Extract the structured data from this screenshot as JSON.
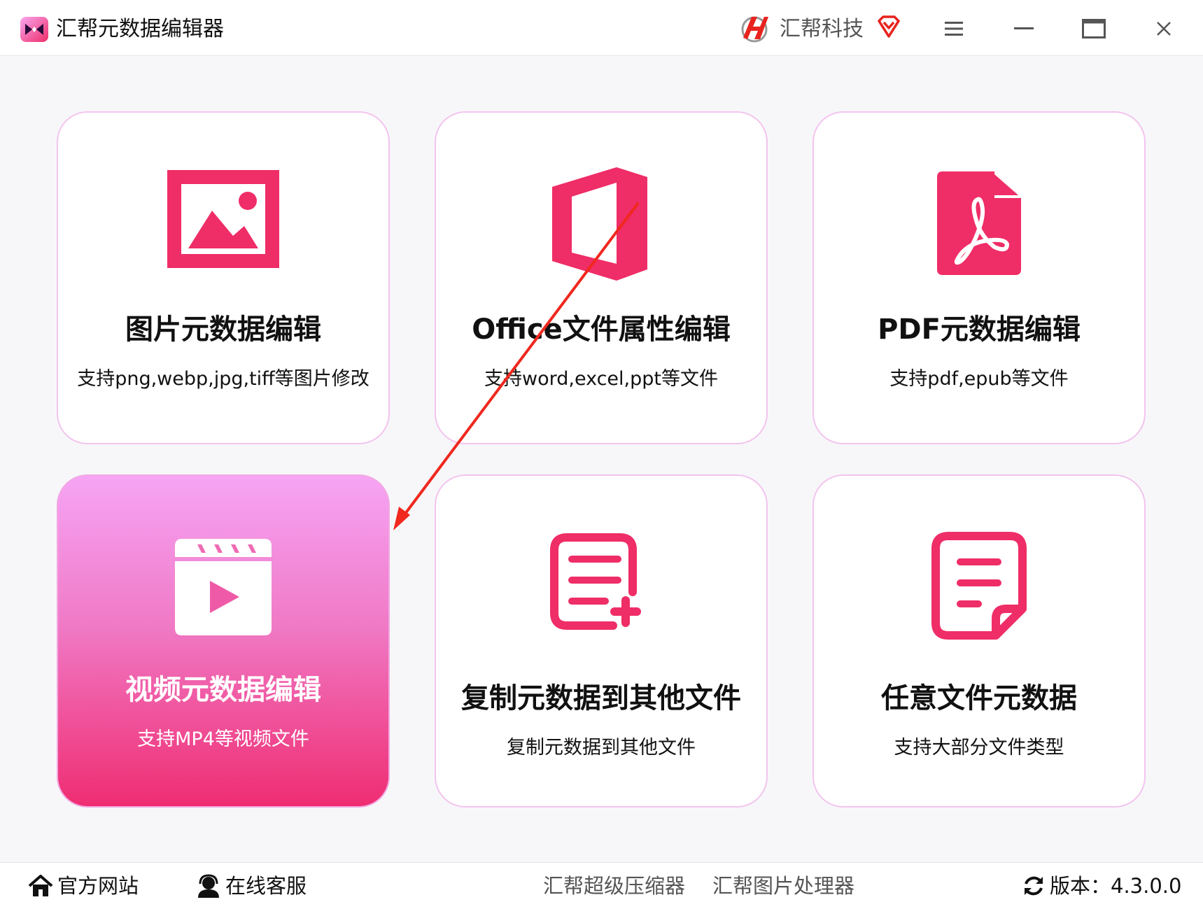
{
  "titlebar": {
    "app_title": "汇帮元数据编辑器",
    "brand_name": "汇帮科技",
    "menu_icon": "hamburger-menu-icon",
    "minimize_icon": "minimize-icon",
    "maximize_icon": "maximize-icon",
    "close_icon": "close-icon"
  },
  "cards": [
    {
      "title": "图片元数据编辑",
      "desc": "支持png,webp,jpg,tiff等图片修改",
      "icon": "image-icon"
    },
    {
      "title": "Office文件属性编辑",
      "desc": "支持word,excel,ppt等文件",
      "icon": "office-icon"
    },
    {
      "title": "PDF元数据编辑",
      "desc": "支持pdf,epub等文件",
      "icon": "pdf-icon"
    },
    {
      "title": "视频元数据编辑",
      "desc": "支持MP4等视频文件",
      "icon": "video-icon",
      "active": true
    },
    {
      "title": "复制元数据到其他文件",
      "desc": "复制元数据到其他文件",
      "icon": "copy-document-icon"
    },
    {
      "title": "任意文件元数据",
      "desc": "支持大部分文件类型",
      "icon": "document-icon"
    }
  ],
  "footer": {
    "website": "官方网站",
    "support": "在线客服",
    "link1": "汇帮超级压缩器",
    "link2": "汇帮图片处理器",
    "version": "版本：4.3.0.0"
  },
  "colors": {
    "accent": "#ef2d66",
    "card_border": "#f3c4ee",
    "active_top": "#f6a4f5",
    "active_bottom": "#ef2d72",
    "annotation_arrow": "#f0281e"
  }
}
